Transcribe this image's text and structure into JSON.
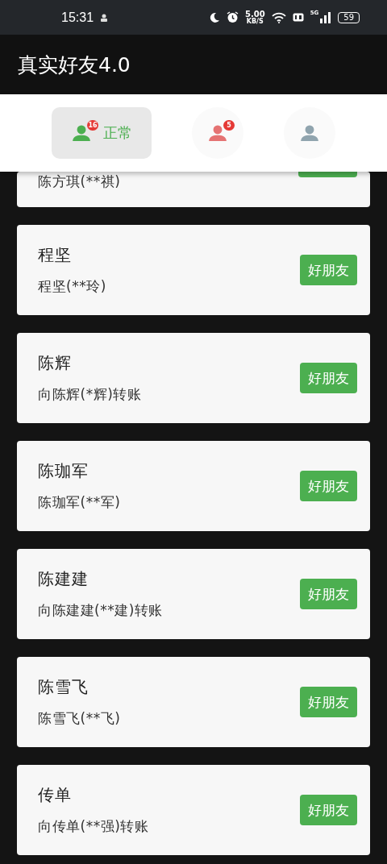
{
  "status_bar": {
    "time": "15:31",
    "speed": "5.00",
    "speed_unit": "KB/S",
    "network": "5G",
    "battery": "59"
  },
  "app_bar": {
    "title": "真实好友4.0"
  },
  "tabs": [
    {
      "label": "正常",
      "badge": "16",
      "selected": true,
      "color": "#4caf50"
    },
    {
      "badge": "5",
      "selected": false,
      "color": "#e57373"
    },
    {
      "selected": false,
      "color": "#90a4ae"
    }
  ],
  "contacts": [
    {
      "kind": "partial",
      "subtitle": "陈方琪(**祺)"
    },
    {
      "kind": "full",
      "name": "程坚",
      "subtitle": "程坚(**玲)",
      "action": "好朋友"
    },
    {
      "kind": "full",
      "name": "陈辉",
      "subtitle": "向陈辉(*辉)转账",
      "action": "好朋友"
    },
    {
      "kind": "full",
      "name": "陈珈军",
      "subtitle": "陈珈军(**军)",
      "action": "好朋友"
    },
    {
      "kind": "full",
      "name": "陈建建",
      "subtitle": "向陈建建(**建)转账",
      "action": "好朋友"
    },
    {
      "kind": "full",
      "name": "陈雪飞",
      "subtitle": "陈雪飞(**飞)",
      "action": "好朋友"
    },
    {
      "kind": "full",
      "name": "传单",
      "subtitle": "向传单(**强)转账",
      "action": "好朋友"
    }
  ]
}
